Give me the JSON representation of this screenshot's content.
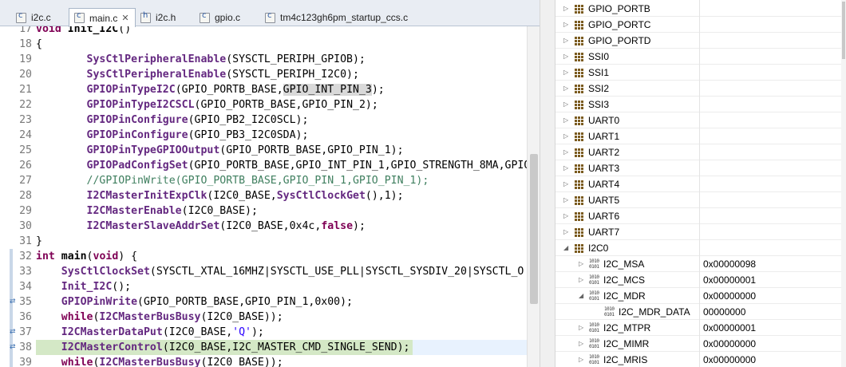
{
  "tabs": [
    {
      "label": "i2c.c",
      "type": "c"
    },
    {
      "label": "main.c",
      "type": "c",
      "active": true,
      "close": "✕"
    },
    {
      "label": "i2c.h",
      "type": "h"
    },
    {
      "label": "gpio.c",
      "type": "c"
    },
    {
      "label": "tm4c123gh6pm_startup_ccs.c",
      "type": "c"
    }
  ],
  "code": [
    {
      "n": "17",
      "t": "void Init_I2C()"
    },
    {
      "n": "18",
      "t": "{"
    },
    {
      "n": "19",
      "t": "        SysCtlPeripheralEnable(SYSCTL_PERIPH_GPIOB);"
    },
    {
      "n": "20",
      "t": "        SysCtlPeripheralEnable(SYSCTL_PERIPH_I2C0);"
    },
    {
      "n": "21",
      "t": "        GPIOPinTypeI2C(GPIO_PORTB_BASE,GPIO_INT_PIN_3);"
    },
    {
      "n": "22",
      "t": "        GPIOPinTypeI2CSCL(GPIO_PORTB_BASE,GPIO_PIN_2);"
    },
    {
      "n": "23",
      "t": "        GPIOPinConfigure(GPIO_PB2_I2C0SCL);"
    },
    {
      "n": "24",
      "t": "        GPIOPinConfigure(GPIO_PB3_I2C0SDA);"
    },
    {
      "n": "25",
      "t": "        GPIOPinTypeGPIOOutput(GPIO_PORTB_BASE,GPIO_PIN_1);"
    },
    {
      "n": "26",
      "t": "        GPIOPadConfigSet(GPIO_PORTB_BASE,GPIO_INT_PIN_1,GPIO_STRENGTH_8MA,GPIO"
    },
    {
      "n": "27",
      "t": "        //GPIOPinWrite(GPIO_PORTB_BASE,GPIO_PIN_1,GPIO_PIN_1);"
    },
    {
      "n": "28",
      "t": "        I2CMasterInitExpClk(I2C0_BASE,SysCtlClockGet(),1);"
    },
    {
      "n": "29",
      "t": "        I2CMasterEnable(I2C0_BASE);"
    },
    {
      "n": "30",
      "t": "        I2CMasterSlaveAddrSet(I2C0_BASE,0x4c,false);"
    },
    {
      "n": "31",
      "t": "}"
    },
    {
      "n": "32",
      "t": "int main(void) {"
    },
    {
      "n": "33",
      "t": "    SysCtlClockSet(SYSCTL_XTAL_16MHZ|SYSCTL_USE_PLL|SYSCTL_SYSDIV_20|SYSCTL_O"
    },
    {
      "n": "34",
      "t": "    Init_I2C();"
    },
    {
      "n": "35",
      "t": "    GPIOPinWrite(GPIO_PORTB_BASE,GPIO_PIN_1,0x00);"
    },
    {
      "n": "36",
      "t": "    while(I2CMasterBusBusy(I2C0_BASE));"
    },
    {
      "n": "37",
      "t": "    I2CMasterDataPut(I2C0_BASE,'Q');"
    },
    {
      "n": "38",
      "t": "    I2CMasterControl(I2C0_BASE,I2C_MASTER_CMD_SINGLE_SEND);"
    },
    {
      "n": "39",
      "t": "    while(I2CMasterBusBusy(I2C0_BASE));"
    }
  ],
  "registers": [
    {
      "name": "GPIO_PORTB",
      "value": "",
      "kind": "group",
      "state": "collapsed",
      "level": 0
    },
    {
      "name": "GPIO_PORTC",
      "value": "",
      "kind": "group",
      "state": "collapsed",
      "level": 0
    },
    {
      "name": "GPIO_PORTD",
      "value": "",
      "kind": "group",
      "state": "collapsed",
      "level": 0
    },
    {
      "name": "SSI0",
      "value": "",
      "kind": "group",
      "state": "collapsed",
      "level": 0
    },
    {
      "name": "SSI1",
      "value": "",
      "kind": "group",
      "state": "collapsed",
      "level": 0
    },
    {
      "name": "SSI2",
      "value": "",
      "kind": "group",
      "state": "collapsed",
      "level": 0
    },
    {
      "name": "SSI3",
      "value": "",
      "kind": "group",
      "state": "collapsed",
      "level": 0
    },
    {
      "name": "UART0",
      "value": "",
      "kind": "group",
      "state": "collapsed",
      "level": 0
    },
    {
      "name": "UART1",
      "value": "",
      "kind": "group",
      "state": "collapsed",
      "level": 0
    },
    {
      "name": "UART2",
      "value": "",
      "kind": "group",
      "state": "collapsed",
      "level": 0
    },
    {
      "name": "UART3",
      "value": "",
      "kind": "group",
      "state": "collapsed",
      "level": 0
    },
    {
      "name": "UART4",
      "value": "",
      "kind": "group",
      "state": "collapsed",
      "level": 0
    },
    {
      "name": "UART5",
      "value": "",
      "kind": "group",
      "state": "collapsed",
      "level": 0
    },
    {
      "name": "UART6",
      "value": "",
      "kind": "group",
      "state": "collapsed",
      "level": 0
    },
    {
      "name": "UART7",
      "value": "",
      "kind": "group",
      "state": "collapsed",
      "level": 0
    },
    {
      "name": "I2C0",
      "value": "",
      "kind": "group",
      "state": "expanded",
      "level": 0
    },
    {
      "name": "I2C_MSA",
      "value": "0x00000098",
      "kind": "reg",
      "state": "collapsed",
      "level": 1
    },
    {
      "name": "I2C_MCS",
      "value": "0x00000001",
      "kind": "reg",
      "state": "collapsed",
      "level": 1
    },
    {
      "name": "I2C_MDR",
      "value": "0x00000000",
      "kind": "reg",
      "state": "expanded",
      "level": 1
    },
    {
      "name": "I2C_MDR_DATA",
      "value": "00000000",
      "kind": "field",
      "state": "none",
      "level": 2
    },
    {
      "name": "I2C_MTPR",
      "value": "0x00000001",
      "kind": "reg",
      "state": "collapsed",
      "level": 1
    },
    {
      "name": "I2C_MIMR",
      "value": "0x00000000",
      "kind": "reg",
      "state": "collapsed",
      "level": 1
    },
    {
      "name": "I2C_MRIS",
      "value": "0x00000000",
      "kind": "reg",
      "state": "collapsed",
      "level": 1
    }
  ],
  "icons": {
    "collapsed": "▷",
    "expanded": "◢",
    "bits": "1010\n0101",
    "close": "close-icon"
  },
  "colors": {
    "keyword": "#7f0055",
    "function": "#642880",
    "comment": "#3f7f5f",
    "string": "#2a00ff",
    "debug_line": "#d4e8c6"
  }
}
